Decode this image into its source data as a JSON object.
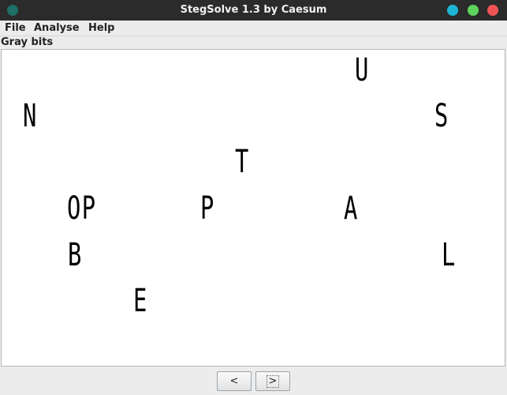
{
  "window": {
    "title": "StegSolve 1.3 by Caesum"
  },
  "menu": {
    "file": "File",
    "analyse": "Analyse",
    "help": "Help"
  },
  "view": {
    "mode_label": "Gray bits"
  },
  "canvas_text": {
    "n": "N",
    "u": "U",
    "s": "S",
    "t": "T",
    "op": "OP",
    "p": "P",
    "a": "A",
    "b": "B",
    "l": "L",
    "e": "E"
  },
  "nav": {
    "prev_label": "<",
    "next_label": ">"
  },
  "colors": {
    "titlebar": "#2b2b2b",
    "background": "#ececec",
    "canvas": "#ffffff"
  }
}
